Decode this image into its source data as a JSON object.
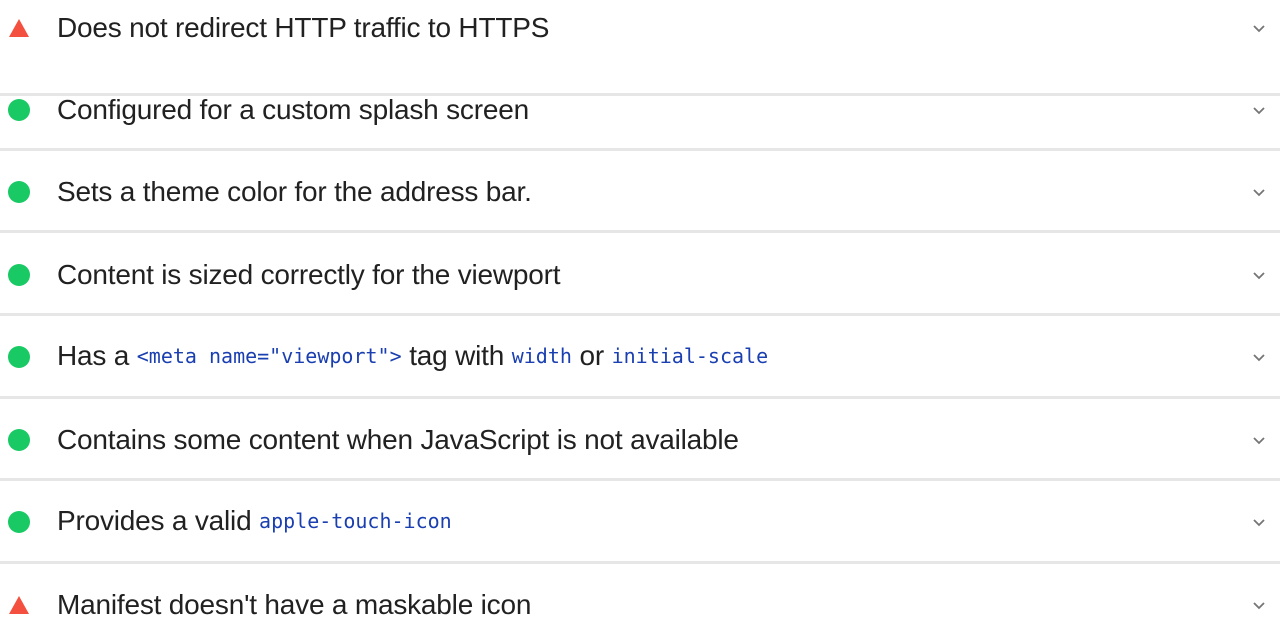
{
  "colors": {
    "pass": "#18c964",
    "warn": "#f4503f",
    "code": "#1a3fb0",
    "text": "#212121",
    "chevron": "#757575"
  },
  "audits": [
    {
      "status": "warn",
      "icon": "warning-triangle-icon",
      "title": "Does not redirect HTTP traffic to HTTPS"
    },
    {
      "status": "pass",
      "icon": "pass-circle-icon",
      "title": "Configured for a custom splash screen"
    },
    {
      "status": "pass",
      "icon": "pass-circle-icon",
      "title": "Sets a theme color for the address bar."
    },
    {
      "status": "pass",
      "icon": "pass-circle-icon",
      "title": "Content is sized correctly for the viewport"
    },
    {
      "status": "pass",
      "icon": "pass-circle-icon",
      "title_parts": [
        {
          "text": "Has a "
        },
        {
          "text": "<meta name=\"viewport\">",
          "code": true
        },
        {
          "text": " tag with "
        },
        {
          "text": "width",
          "code": true
        },
        {
          "text": " or "
        },
        {
          "text": "initial-scale",
          "code": true
        }
      ]
    },
    {
      "status": "pass",
      "icon": "pass-circle-icon",
      "title": "Contains some content when JavaScript is not available"
    },
    {
      "status": "pass",
      "icon": "pass-circle-icon",
      "title_parts": [
        {
          "text": "Provides a valid "
        },
        {
          "text": "apple-touch-icon",
          "code": true
        }
      ]
    },
    {
      "status": "warn",
      "icon": "warning-triangle-icon",
      "title": "Manifest doesn't have a maskable icon"
    }
  ]
}
